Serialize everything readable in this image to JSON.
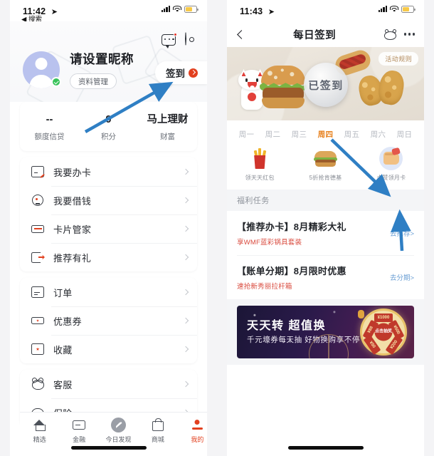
{
  "left": {
    "status": {
      "time": "11:42",
      "back_label": "搜索"
    },
    "header": {
      "chat_icon": "chat-bubble-icon",
      "settings_icon": "gear-icon"
    },
    "profile": {
      "nickname": "请设置昵称",
      "manage_label": "资料管理",
      "signin_label": "签到"
    },
    "stats": [
      {
        "value": "--",
        "label": "额度信贷"
      },
      {
        "value": "9",
        "label": "积分"
      },
      {
        "value": "马上理财",
        "label": "财富"
      }
    ],
    "menu_groups": [
      [
        {
          "label": "我要办卡",
          "icon": "card-apply-icon"
        },
        {
          "label": "我要借钱",
          "icon": "loan-icon"
        },
        {
          "label": "卡片管家",
          "icon": "wallet-icon"
        },
        {
          "label": "推荐有礼",
          "icon": "refer-icon"
        }
      ],
      [
        {
          "label": "订单",
          "icon": "order-icon"
        },
        {
          "label": "优惠券",
          "icon": "coupon-icon"
        },
        {
          "label": "收藏",
          "icon": "favorite-icon"
        }
      ],
      [
        {
          "label": "客服",
          "icon": "service-cat-icon"
        },
        {
          "label": "保险",
          "icon": "insurance-icon"
        }
      ]
    ],
    "tabs": [
      {
        "label": "精选",
        "icon": "home-icon",
        "active": false
      },
      {
        "label": "金融",
        "icon": "finance-card-icon",
        "active": false
      },
      {
        "label": "今日发现",
        "icon": "discover-icon",
        "active": false
      },
      {
        "label": "商城",
        "icon": "mall-bag-icon",
        "active": false
      },
      {
        "label": "我的",
        "icon": "profile-icon",
        "active": true
      }
    ]
  },
  "right": {
    "status": {
      "time": "11:43"
    },
    "nav": {
      "title": "每日签到",
      "back_icon": "back-chevron-icon",
      "cat_icon": "cat-icon",
      "more_icon": "more-dots-icon"
    },
    "banner": {
      "rules_label": "活动规则",
      "signed_label": "已签到"
    },
    "weekdays": [
      {
        "label": "周一",
        "active": false
      },
      {
        "label": "周二",
        "active": false
      },
      {
        "label": "周三",
        "active": false
      },
      {
        "label": "周四",
        "active": true
      },
      {
        "label": "周五",
        "active": false
      },
      {
        "label": "周六",
        "active": false
      },
      {
        "label": "周日",
        "active": false
      }
    ],
    "rewards": [
      {
        "label": "领天天红包",
        "icon": "fries-red-packet-icon"
      },
      {
        "label": "5折抢肯德基",
        "icon": "burger-icon"
      },
      {
        "label": "点赞领月卡",
        "icon": "thumbs-up-card-icon"
      }
    ],
    "tasks_section_title": "福利任务",
    "tasks": [
      {
        "title": "【推荐办卡】8月精彩大礼",
        "sub": "享WMF蓝彩锅具套装",
        "action": "去推荐>"
      },
      {
        "title": "【账单分期】8月限时优惠",
        "sub": "速抢新秀丽拉杆箱",
        "action": "去分期>"
      }
    ],
    "promo": {
      "title": "天天转 超值换",
      "subtitle": "千元壕券每天抽 好物换购享不停",
      "wheel_center": "点击抽奖",
      "wheel_segments": [
        "¥1000",
        "¥500",
        "¥200",
        "¥50",
        "¥88"
      ]
    }
  },
  "colors": {
    "accent": "#e2401f",
    "highlight": "#e8821f",
    "link": "#6b9fd4",
    "annotation": "#2f7fc4"
  }
}
